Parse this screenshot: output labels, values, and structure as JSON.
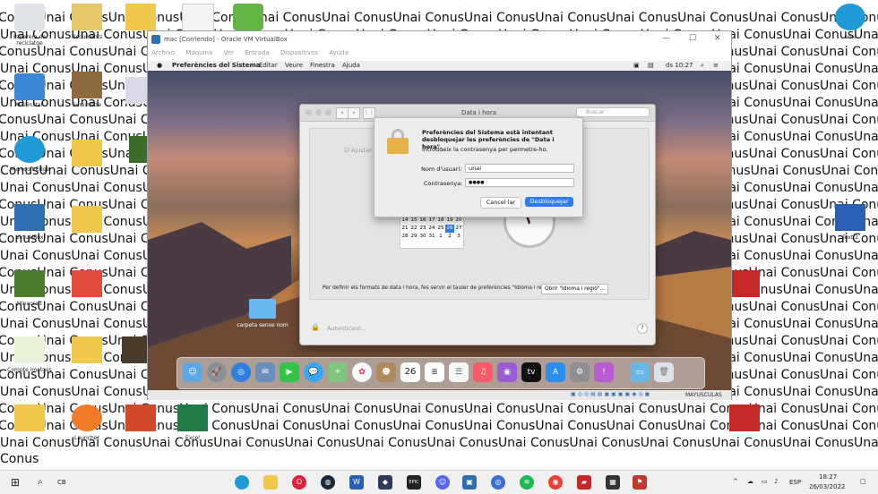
{
  "wallpaper": {
    "line_a": "ConusUnai ConusUnai ConusUnai ConusUnai ConusUnai ConusUnai ConusUnai ConusUnai ConusUnai ConusUnai ConusUnai ConusUnai Conus",
    "line_b": "Unai ConusUnai ConusUnai ConusUnai ConusUnai ConusUnai ConusUnai ConusUnai ConusUnai ConusUnai ConusUnai ConusUnai ConusUnai",
    "line_c": "Conus"
  },
  "desktop_icons": [
    {
      "label": "Paperera de reciclatge"
    },
    {
      "label": "Documents"
    },
    {
      "label": "unai"
    },
    {
      "label": "Autoinstal."
    },
    {
      "label": "Suministre"
    },
    {
      "label": "Microsoft Edge"
    },
    {
      "label": "VirtualBox"
    },
    {
      "label": "Minecraft"
    },
    {
      "label": "Compte imatges"
    },
    {
      "label": "Launcher"
    },
    {
      "label": "Document"
    },
    {
      "label": "Recursos"
    },
    {
      "label": "Ordres"
    },
    {
      "label": "Excel"
    },
    {
      "label": "Text 2"
    },
    {
      "label": "Text 3"
    }
  ],
  "vbox": {
    "title": "mac [Corriendo] - Oracle VM VirtualBox",
    "menu": [
      "Archivo",
      "Máquina",
      "Ver",
      "Entrada",
      "Dispositivos",
      "Ayuda"
    ],
    "status_text": "MAYUSCULAS"
  },
  "mac": {
    "menu": [
      "Preferències del Sistema",
      "Editar",
      "Veure",
      "Finestra",
      "Ajuda"
    ],
    "clock": "ds 10:27",
    "prefs_title": "Data i hora",
    "search_placeholder": "Buscar",
    "adjust_label": "Ajustar la data",
    "calendar_rows": [
      [
        "7",
        "8",
        "9",
        "10",
        "11",
        "12",
        "13"
      ],
      [
        "14",
        "15",
        "16",
        "17",
        "18",
        "19",
        "20"
      ],
      [
        "21",
        "22",
        "23",
        "24",
        "25",
        "26",
        "27"
      ],
      [
        "28",
        "29",
        "30",
        "31",
        "1",
        "2",
        "3"
      ]
    ],
    "calendar_selected": "26",
    "footer_text": "Per definir els formats de data i hora, fes servir el tauler de preferències \"Idioma i regió\".",
    "open_region_button": "Obrir \"Idioma i regió\"...",
    "lock_label": "Autenticant...",
    "help": "?",
    "folder_label": "carpeta sense nom"
  },
  "auth": {
    "title": "Preferències del Sistema està intentant desbloquejar les preferències de \"Data i hora\".",
    "subtitle": "Introdueix la contrasenya per permetre-ho.",
    "user_label": "Nom d'usuari:",
    "user_value": "unai",
    "pass_label": "Contrasenya:",
    "pass_value": "●●●●",
    "cancel": "Cancel·lar",
    "unlock": "Desbloquejar"
  },
  "taskbar": {
    "search": "CB",
    "lang": "ESP",
    "time": "18:27",
    "date": "26/03/2022"
  },
  "colors": {
    "accent": "#2d7cf6",
    "taskbar": "#f0f0f0"
  }
}
